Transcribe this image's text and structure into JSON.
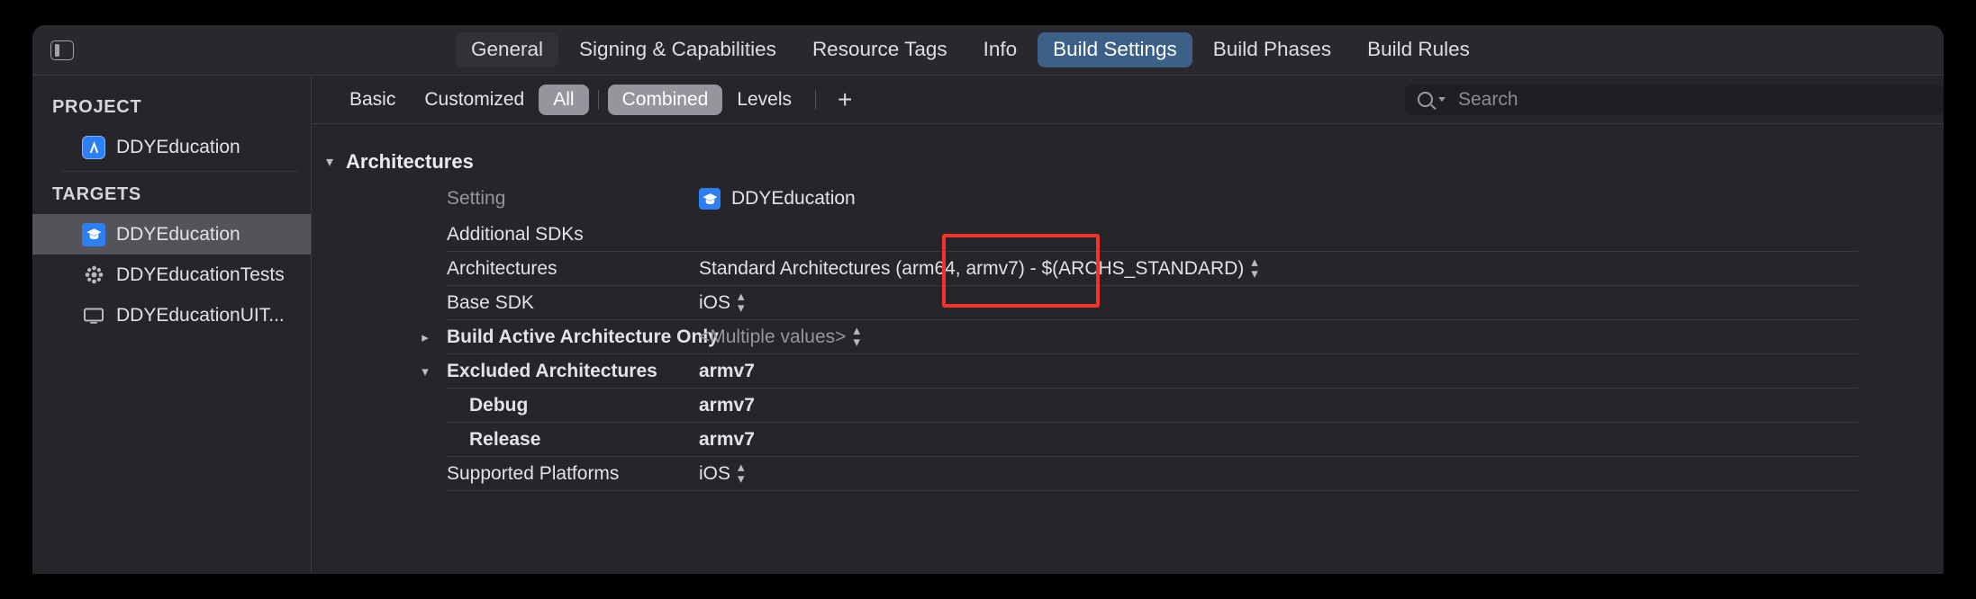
{
  "window": {
    "sidebar_toggle_icon": "sidebar-toggle-icon"
  },
  "tabs": [
    {
      "label": "General",
      "state": "hovered"
    },
    {
      "label": "Signing & Capabilities",
      "state": "normal"
    },
    {
      "label": "Resource Tags",
      "state": "normal"
    },
    {
      "label": "Info",
      "state": "normal"
    },
    {
      "label": "Build Settings",
      "state": "active"
    },
    {
      "label": "Build Phases",
      "state": "normal"
    },
    {
      "label": "Build Rules",
      "state": "normal"
    }
  ],
  "sidebar": {
    "project_header": "PROJECT",
    "targets_header": "TARGETS",
    "project_items": [
      {
        "label": "DDYEducation",
        "icon": "xcode-project-icon",
        "selected": false
      }
    ],
    "target_items": [
      {
        "label": "DDYEducation",
        "icon": "app-target-icon",
        "selected": true
      },
      {
        "label": "DDYEducationTests",
        "icon": "unit-test-target-icon",
        "selected": false
      },
      {
        "label": "DDYEducationUIT...",
        "icon": "ui-test-target-icon",
        "selected": false
      }
    ]
  },
  "filterbar": {
    "segments": [
      {
        "label": "Basic",
        "selected": false
      },
      {
        "label": "Customized",
        "selected": false
      },
      {
        "label": "All",
        "selected": true
      },
      {
        "label": "Combined",
        "selected": true
      },
      {
        "label": "Levels",
        "selected": false
      }
    ],
    "add_label": "+",
    "search": {
      "placeholder": "Search",
      "value": "",
      "icon": "search-icon"
    }
  },
  "settings": {
    "group_title": "Architectures",
    "columns": {
      "setting": "Setting",
      "target": "DDYEducation"
    },
    "rows": [
      {
        "name": "Additional SDKs",
        "value": "",
        "bold": false,
        "indent": false,
        "disclosure": "none",
        "stepper": false
      },
      {
        "name": "Architectures",
        "value": "Standard Architectures (arm64, armv7)  -  $(ARCHS_STANDARD)",
        "bold": false,
        "indent": false,
        "disclosure": "none",
        "stepper": true
      },
      {
        "name": "Base SDK",
        "value": "iOS",
        "bold": false,
        "indent": false,
        "disclosure": "none",
        "stepper": true
      },
      {
        "name": "Build Active Architecture Only",
        "value": "<Multiple values>",
        "bold": true,
        "indent": false,
        "disclosure": "collapsed",
        "stepper": true,
        "muted": true
      },
      {
        "name": "Excluded Architectures",
        "value": "armv7",
        "bold": true,
        "indent": false,
        "disclosure": "expanded",
        "stepper": false
      },
      {
        "name": "Debug",
        "value": "armv7",
        "bold": true,
        "indent": true,
        "disclosure": "none",
        "stepper": false
      },
      {
        "name": "Release",
        "value": "armv7",
        "bold": true,
        "indent": true,
        "disclosure": "none",
        "stepper": false
      },
      {
        "name": "Supported Platforms",
        "value": "iOS",
        "bold": false,
        "indent": false,
        "disclosure": "none",
        "stepper": true
      }
    ]
  },
  "annotation": {
    "highlight_color": "#f4342c",
    "highlight_target": "Excluded Architectures armv7 values"
  }
}
